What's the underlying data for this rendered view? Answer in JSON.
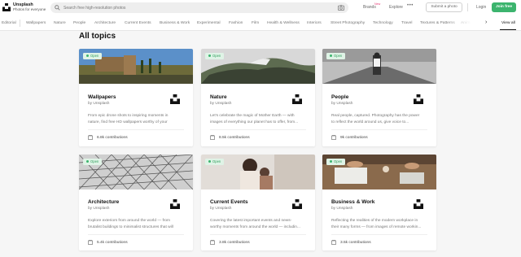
{
  "header": {
    "brand_name": "Unsplash",
    "brand_tagline": "Photos for everyone",
    "search_placeholder": "Search free high-resolution photos",
    "nav": {
      "brands": "Brands",
      "new_badge": "New",
      "explore": "Explore"
    },
    "more": "•••",
    "submit": "Submit a photo",
    "login": "Login",
    "join": "Join free"
  },
  "topic_nav": {
    "items": [
      "Editorial",
      "Wallpapers",
      "Nature",
      "People",
      "Architecture",
      "Current Events",
      "Business & Work",
      "Experimental",
      "Fashion",
      "Film",
      "Health & Wellness",
      "Interiors",
      "Street Photography",
      "Technology",
      "Travel",
      "Textures & Patterns",
      "Animals"
    ],
    "view_all": "View all"
  },
  "page_title": "All topics",
  "cards": [
    {
      "badge": "Open",
      "title": "Wallpapers",
      "by": "by Unsplash",
      "desc_line1": "From epic drone shots to inspiring moments in",
      "desc_line2": "nature, find free HD wallpapers worthy of your",
      "contributions": "6.8k contributions"
    },
    {
      "badge": "Open",
      "title": "Nature",
      "by": "by Unsplash",
      "desc_line1": "Let's celebrate the magic of Mother Earth — with",
      "desc_line2": "images of everything our planet has to offer, from...",
      "contributions": "8.5k contributions"
    },
    {
      "badge": "Open",
      "title": "People",
      "by": "by Unsplash",
      "desc_line1": "Real people, captured. Photography has the power",
      "desc_line2": "to reflect the world around us, give voice to...",
      "contributions": "9k contributions"
    },
    {
      "badge": "Open",
      "title": "Architecture",
      "by": "by Unsplash",
      "desc_line1": "Explore exteriors from around the world — from",
      "desc_line2": "brutalist buildings to minimalist structures that will",
      "contributions": "5.4k contributions"
    },
    {
      "badge": "Open",
      "title": "Current Events",
      "by": "by Unsplash",
      "desc_line1": "Covering the latest important events and news-",
      "desc_line2": "worthy moments from around the world — includin...",
      "contributions": "3.8k contributions"
    },
    {
      "badge": "Open",
      "title": "Business & Work",
      "by": "by Unsplash",
      "desc_line1": "Reflecting the realities of the modern workplace in",
      "desc_line2": "their many forms — from images of remote workin...",
      "contributions": "3.5k contributions"
    }
  ],
  "colors": {
    "accent": "#3cb46e",
    "badge_bg": "#dff3e6",
    "new_badge": "#e7417a"
  }
}
